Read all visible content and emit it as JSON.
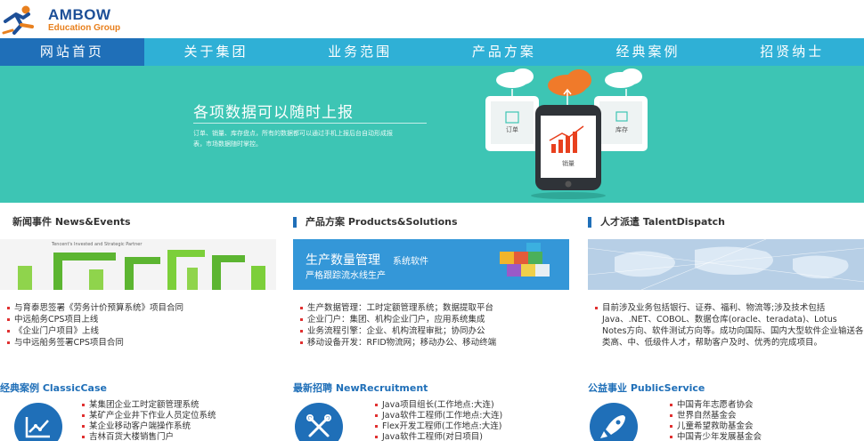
{
  "header": {
    "brand": "AMBOW",
    "subtitle": "Education Group"
  },
  "nav": {
    "items": [
      {
        "label": "网站首页",
        "active": true
      },
      {
        "label": "关于集团",
        "active": false
      },
      {
        "label": "业务范围",
        "active": false
      },
      {
        "label": "产品方案",
        "active": false
      },
      {
        "label": "经典案例",
        "active": false
      },
      {
        "label": "招贤纳士",
        "active": false
      }
    ]
  },
  "banner": {
    "title": "各项数据可以随时上报",
    "text": "订单、销量、库存盘点，所有的数据都可以通过手机上报后台自动形成报表，市场数据随时掌控。",
    "labels": {
      "order": "订单",
      "sales": "销量",
      "stock": "库存"
    }
  },
  "news": {
    "title": "新闻事件 News&Events",
    "image_caption": "Tencent's Invested and Strategic Partner",
    "items": [
      "与育泰思签署《劳务计价预算系统》项目合同",
      "中远船务CPS项目上线",
      "《企业门户项目》上线",
      "与中远船务签署CPS项目合同"
    ]
  },
  "products": {
    "title": "产品方案 Products&Solutions",
    "banner_main": "生产数量管理",
    "banner_main_suffix": "系统软件",
    "banner_sub": "严格跟踪流水线生产",
    "items": [
      "生产数据管理：工时定额管理系统；数据提取平台",
      "企业门户：集团、机构企业门户，应用系统集成",
      "业务流程引擎：企业、机构流程审批；协同办公",
      "移动设备开发：RFID物流网；移动办公、移动终端"
    ]
  },
  "talent": {
    "title": "人才派遣 TalentDispatch",
    "text": "目前涉及业务包括银行、证券、福利、物流等;涉及技术包括Java、.NET、COBOL、数据仓库(oracle、teradata)、Lotus Notes方向、软件测试方向等。成功向国际、国内大型软件企业输送各类高、中、低级件人才，帮助客户及时、优秀的完成项目。"
  },
  "classic": {
    "title": "经典案例 ClassicCase",
    "items": [
      "某集团企业工时定额管理系统",
      "某矿产企业井下作业人员定位系统",
      "某企业移动客户端操作系统",
      "吉林百货大楼销售门户"
    ]
  },
  "recruit": {
    "title": "最新招聘 NewRecruitment",
    "items": [
      "Java项目组长(工作地点:大连)",
      "Java软件工程师(工作地点:大连)",
      "Flex开发工程师(工作地点:大连)",
      "Java软件工程师(对日项目)"
    ]
  },
  "public": {
    "title": "公益事业 PublicService",
    "items": [
      "中国青年志愿者协会",
      "世界自然基金会",
      "儿童希望救助基金会",
      "中国青少年发展基金会"
    ]
  },
  "colors": {
    "nav": "#2fb0d6",
    "nav_active": "#1f6fb8",
    "banner": "#3dc5b4",
    "accent": "#1f6fb8"
  }
}
